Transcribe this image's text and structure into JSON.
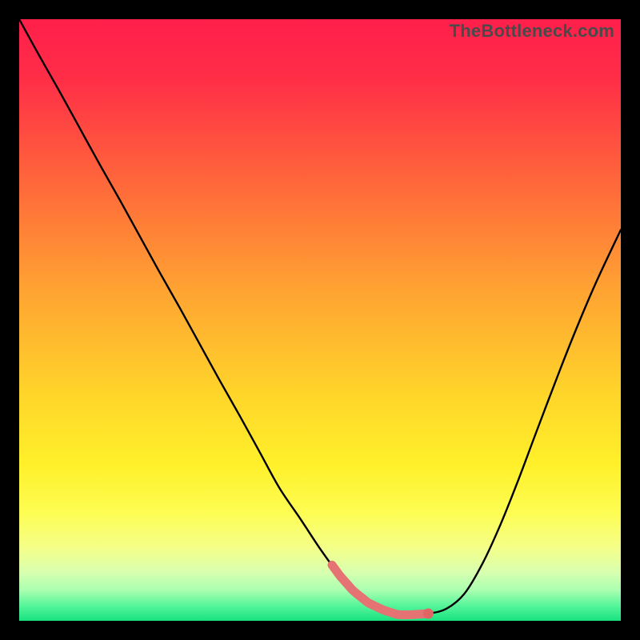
{
  "watermark": "TheBottleneck.com",
  "colors": {
    "frame": "#000000",
    "curve": "#000000",
    "highlight": "#e57373",
    "highlight_dot": "#e06666",
    "gradient_stops": [
      {
        "offset": 0.0,
        "color": "#ff1f4b"
      },
      {
        "offset": 0.1,
        "color": "#ff2e47"
      },
      {
        "offset": 0.28,
        "color": "#ff6a3a"
      },
      {
        "offset": 0.45,
        "color": "#ffa332"
      },
      {
        "offset": 0.62,
        "color": "#ffd42a"
      },
      {
        "offset": 0.74,
        "color": "#fff02a"
      },
      {
        "offset": 0.82,
        "color": "#fdfd52"
      },
      {
        "offset": 0.88,
        "color": "#f4ff8a"
      },
      {
        "offset": 0.92,
        "color": "#d7ffb0"
      },
      {
        "offset": 0.95,
        "color": "#a8ffb0"
      },
      {
        "offset": 0.975,
        "color": "#55f59a"
      },
      {
        "offset": 1.0,
        "color": "#18e27f"
      }
    ]
  },
  "chart_data": {
    "type": "line",
    "title": "",
    "xlabel": "",
    "ylabel": "",
    "xlim": [
      0,
      1
    ],
    "ylim": [
      0,
      1
    ],
    "x": [
      0.0,
      0.033,
      0.067,
      0.1,
      0.133,
      0.167,
      0.2,
      0.233,
      0.267,
      0.3,
      0.333,
      0.367,
      0.4,
      0.433,
      0.467,
      0.5,
      0.533,
      0.555,
      0.58,
      0.605,
      0.63,
      0.65,
      0.68,
      0.71,
      0.74,
      0.77,
      0.8,
      0.83,
      0.86,
      0.9,
      0.93,
      0.96,
      1.0
    ],
    "series": [
      {
        "name": "bottleneck-curve",
        "values": [
          1.0,
          0.94,
          0.88,
          0.82,
          0.76,
          0.7,
          0.64,
          0.58,
          0.52,
          0.46,
          0.4,
          0.34,
          0.28,
          0.22,
          0.17,
          0.12,
          0.075,
          0.05,
          0.03,
          0.018,
          0.01,
          0.01,
          0.012,
          0.02,
          0.045,
          0.095,
          0.16,
          0.235,
          0.315,
          0.42,
          0.495,
          0.565,
          0.65
        ]
      }
    ],
    "highlight_region": {
      "x_start": 0.52,
      "x_end": 0.68
    },
    "highlight_dot_x": 0.68
  }
}
